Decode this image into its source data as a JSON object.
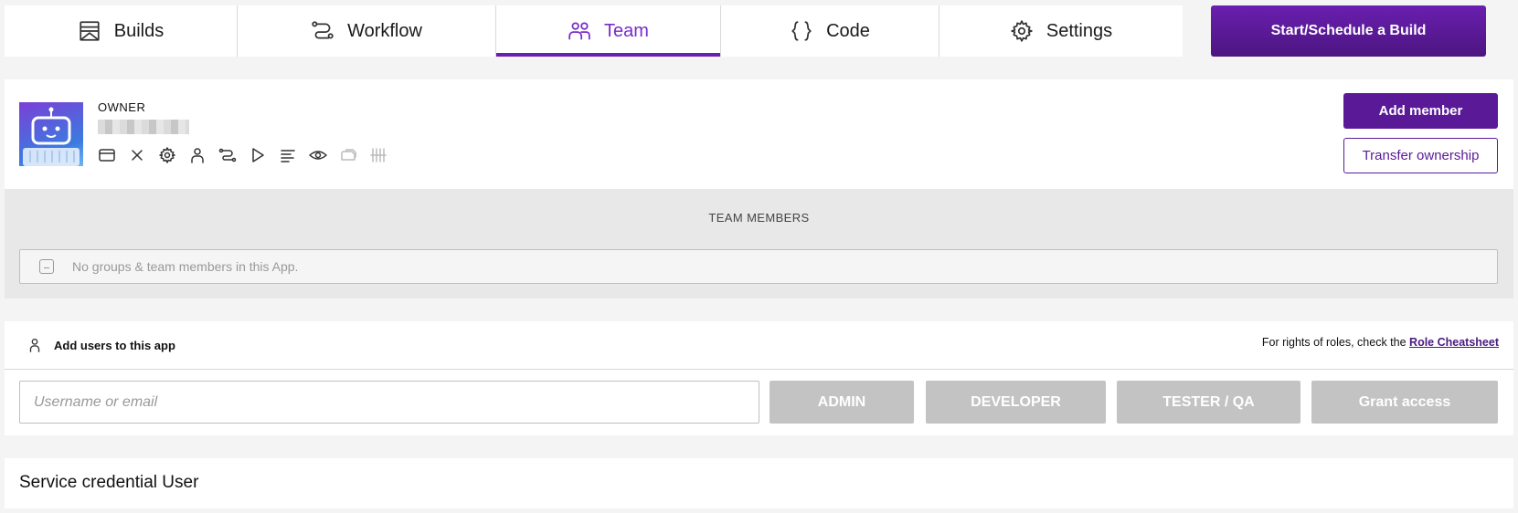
{
  "tabs": [
    {
      "label": "Builds",
      "icon": "builds-icon"
    },
    {
      "label": "Workflow",
      "icon": "workflow-icon"
    },
    {
      "label": "Team",
      "icon": "team-icon",
      "active": true
    },
    {
      "label": "Code",
      "icon": "code-icon"
    },
    {
      "label": "Settings",
      "icon": "gear-icon"
    }
  ],
  "actions": {
    "start_build": "Start/Schedule a Build"
  },
  "owner": {
    "label": "OWNER",
    "add_member": "Add member",
    "transfer": "Transfer ownership",
    "permission_icons": [
      "card-icon",
      "close-icon",
      "gear-icon",
      "person-icon",
      "workflow-icon",
      "play-icon",
      "list-icon",
      "eye-icon",
      "cloud-icon",
      "equalizer-icon"
    ]
  },
  "team": {
    "title": "TEAM MEMBERS",
    "empty": "No groups & team members in this App."
  },
  "add_users": {
    "label": "Add users to this app",
    "rights_prefix": "For rights of roles, check the",
    "rights_link": "Role Cheatsheet",
    "input_placeholder": "Username or email",
    "roles": {
      "admin": "ADMIN",
      "developer": "DEVELOPER",
      "tester": "TESTER / QA"
    },
    "grant": "Grant access"
  },
  "service": {
    "title": "Service credential User"
  },
  "colors": {
    "accent": "#6a1fb0",
    "accent_dark": "#5a1a98",
    "disabled": "#c3c3c3"
  }
}
